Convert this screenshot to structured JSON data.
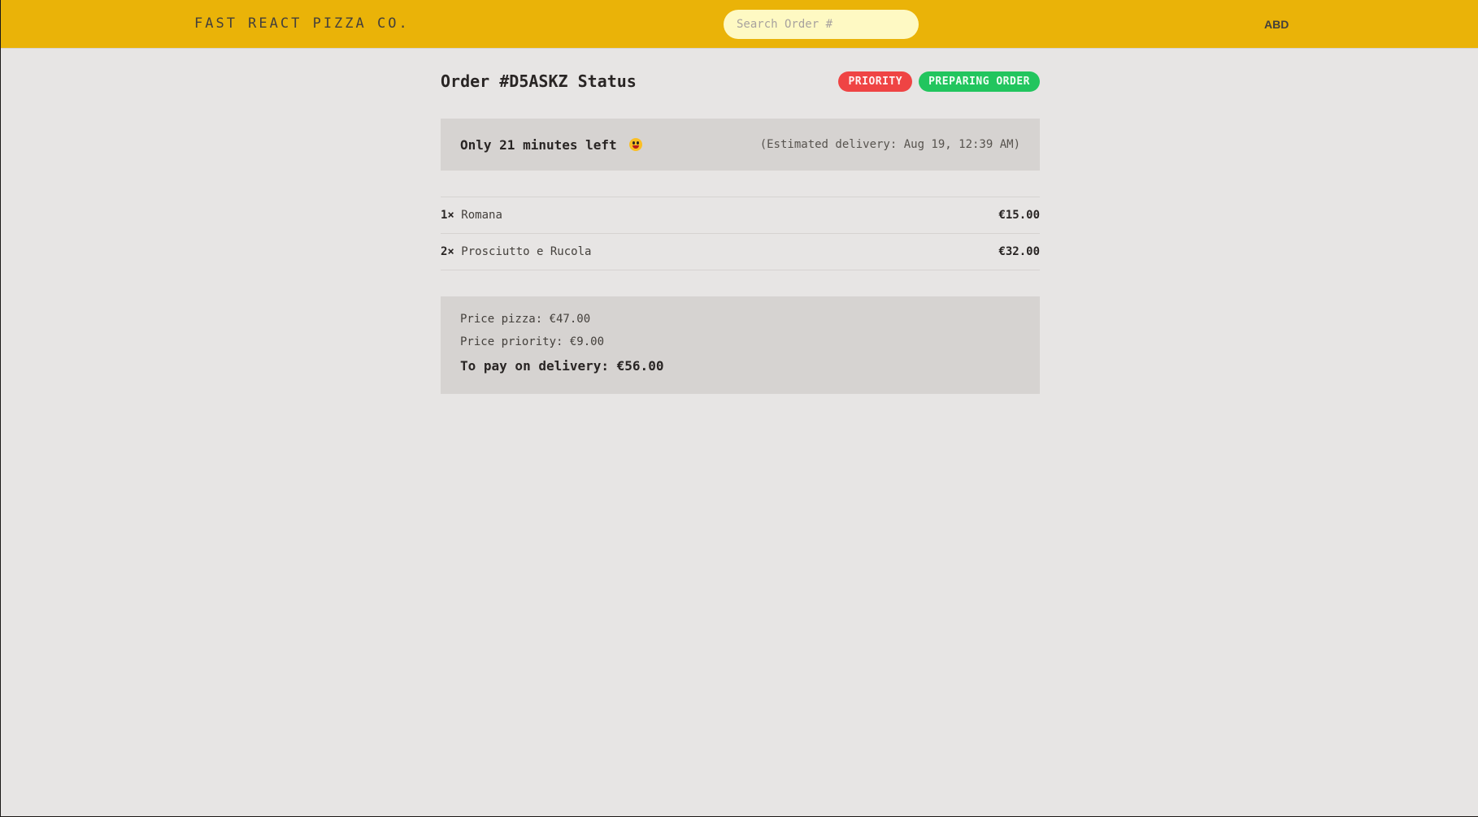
{
  "header": {
    "logo": "Fast React Pizza Co.",
    "search_placeholder": "Search Order #",
    "username": "ABD"
  },
  "order": {
    "title": "Order #D5ASKZ Status",
    "badges": {
      "priority": "Priority",
      "status": "Preparing order"
    },
    "eta": {
      "main": "Only 21 minutes left",
      "emoji": "grinning-face-icon",
      "estimated": "(Estimated delivery: Aug 19, 12:39 AM)"
    },
    "items": [
      {
        "qty": "1×",
        "name": "Romana",
        "price": "€15.00"
      },
      {
        "qty": "2×",
        "name": "Prosciutto e Rucola",
        "price": "€32.00"
      }
    ],
    "totals": {
      "price_pizza": "Price pizza: €47.00",
      "price_priority": "Price priority: €9.00",
      "to_pay": "To pay on delivery: €56.00"
    }
  },
  "colors": {
    "header_bg": "#eab308",
    "priority_badge": "#ef4444",
    "status_badge": "#22c55e",
    "page_bg": "#e7e5e4"
  }
}
